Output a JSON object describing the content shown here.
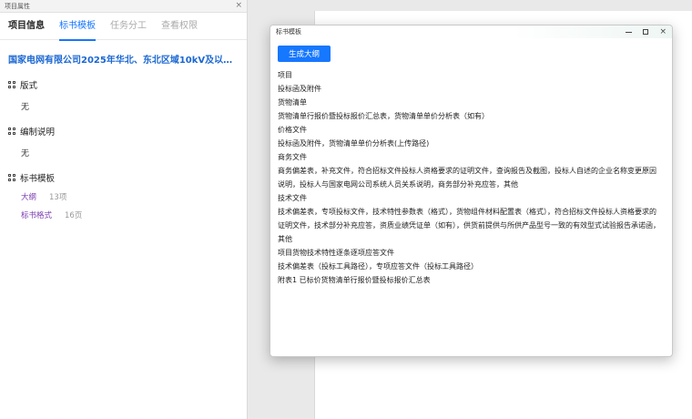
{
  "left_panel": {
    "title": "项目属性",
    "close_glyph": "×",
    "tabs": [
      {
        "label": "项目信息"
      },
      {
        "label": "标书模板"
      },
      {
        "label": "任务分工"
      },
      {
        "label": "查看权限"
      }
    ],
    "project_title": "国家电网有限公司2025年华北、东北区域10kV及以下电缆附件协...",
    "sections": {
      "format": {
        "label": "版式",
        "value": "无"
      },
      "instructions": {
        "label": "编制说明",
        "value": "无"
      },
      "templates": {
        "label": "标书模板",
        "items": [
          {
            "name": "大纲",
            "count": "13项"
          },
          {
            "name": "标书格式",
            "count": "16页"
          }
        ]
      }
    }
  },
  "dialog": {
    "title": "标书模板",
    "controls": {
      "minimize": "minimize-icon",
      "maximize": "maximize-icon",
      "close": "×"
    },
    "generate_button": "生成大纲",
    "outline": [
      "项目",
      "投标函及附件",
      "货物清单",
      "货物清单行报价暨投标报价汇总表，货物清单单价分析表（如有）",
      "价格文件",
      "投标函及附件，货物清单单价分析表(上传路径)",
      "商务文件",
      "商务偏差表，补充文件，符合招标文件投标人资格要求的证明文件，查询报告及截图，投标人自述的企业名称变更原因",
      "说明，投标人与国家电网公司系统人员关系说明，商务部分补充应答，其他",
      "技术文件",
      "技术偏差表，专项投标文件，技术特性参数表（格式），货物组件材料配置表（格式），符合招标文件投标人资格要求的",
      "证明文件，技术部分补充应答，资质业绩凭证单（如有），供货前提供与所供产品型号一致的有效型式试验报告承诺函，",
      "其他",
      "项目货物技术特性逐条逐项应答文件",
      "技术偏差表（投标工具路径），专项应答文件（投标工具路径）",
      "附表1 已标价货物清单行报价暨投标报价汇总表"
    ]
  },
  "colors": {
    "accent": "#1677ff",
    "title_blue": "#1a67d2",
    "template_purple": "#7a3bb0"
  }
}
